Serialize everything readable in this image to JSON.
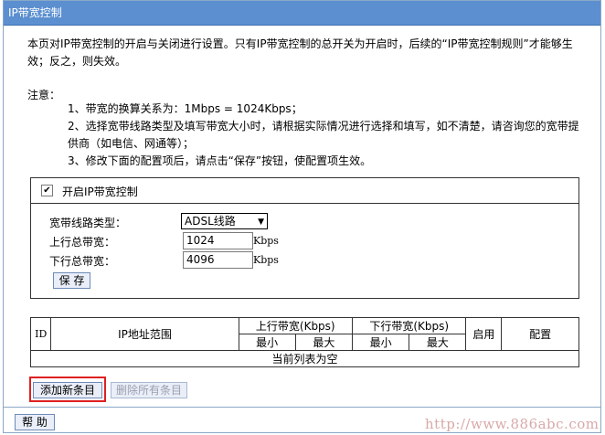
{
  "title": "IP带宽控制",
  "intro": "本页对IP带宽控制的开启与关闭进行设置。只有IP带宽控制的总开关为开启时，后续的“IP带宽控制规则”才能够生效；反之，则失效。",
  "notes_title": "注意：",
  "notes": [
    "1、带宽的换算关系为：1Mbps = 1024Kbps；",
    "2、选择宽带线路类型及填写带宽大小时，请根据实际情况进行选择和填写，如不清楚，请咨询您的宽带提供商（如电信、网通等）；",
    "3、修改下面的配置项后，请点击“保存”按钮，使配置项生效。"
  ],
  "config": {
    "enable_label": "开启IP带宽控制",
    "enable_checked": true,
    "line_type_label": "宽带线路类型：",
    "line_type_value": "ADSL线路",
    "up_label": "上行总带宽：",
    "up_value": "1024",
    "down_label": "下行总带宽：",
    "down_value": "4096",
    "unit": "Kbps",
    "save_label": "保 存"
  },
  "table": {
    "id": "ID",
    "ip_range": "IP地址范围",
    "up_bw": "上行带宽(Kbps)",
    "down_bw": "下行带宽(Kbps)",
    "min": "最小",
    "max": "最大",
    "enable": "启用",
    "config": "配置",
    "empty": "当前列表为空"
  },
  "buttons": {
    "add": "添加新条目",
    "delete_all": "删除所有条目",
    "help": "帮 助"
  },
  "watermark": "http://www.886abc.com",
  "colors": {
    "titlebar": "#5b8fd0",
    "highlight": "#e02020"
  }
}
